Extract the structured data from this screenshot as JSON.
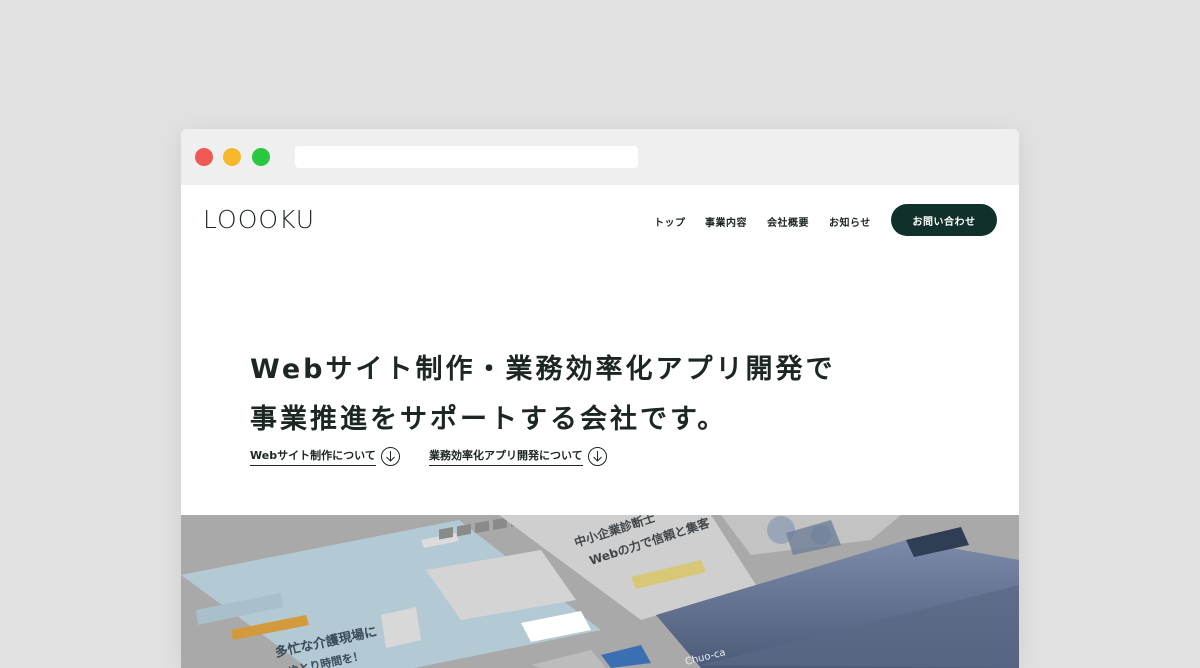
{
  "site": {
    "logo_text": "LOOOKU",
    "nav": [
      "トップ",
      "事業内容",
      "会社概要",
      "お知らせ"
    ],
    "contact_button": "お問い合わせ"
  },
  "hero": {
    "headline_line1": "Webサイト制作・業務効率化アプリ開発で",
    "headline_line2": "事業推進をサポートする会社です。",
    "links": [
      "Webサイト制作について",
      "業務効率化アプリ開発について"
    ]
  },
  "showcase": {
    "card1_text_a": "多忙な介護現場に",
    "card1_text_b": "ゆとり時間を！",
    "card2_text_a": "中小企業診断士",
    "card2_text_b": "Webの力で信頼と集客",
    "card3_logo": "Chuo-ca"
  },
  "colors": {
    "brand_dark": "#10302b",
    "text": "#1c2622",
    "background": "#e1e1e1",
    "showcase_bg": "#a9a9a9"
  }
}
